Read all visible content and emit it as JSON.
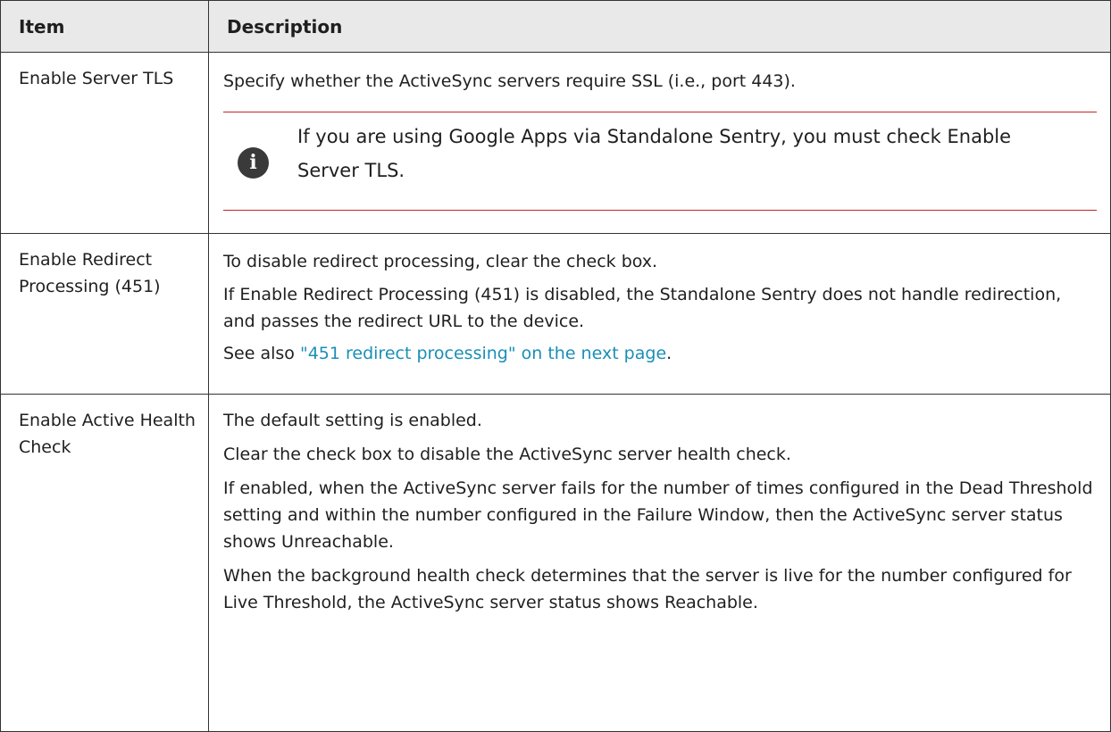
{
  "table": {
    "headers": [
      "Item",
      "Description"
    ],
    "rows": [
      {
        "item": "Enable Server TLS",
        "desc": [
          "Specify whether the ActiveSync servers require SSL (i.e., port 443)."
        ],
        "note": "If you are using Google Apps via Standalone Sentry, you must check Enable Server TLS."
      },
      {
        "item": "Enable Redirect Processing (451)",
        "desc": [
          "To disable redirect processing, clear the check box.",
          "If Enable Redirect Processing (451) is disabled, the Standalone Sentry does not handle redirection, and passes the redirect URL to the device."
        ],
        "see_also_prefix": "See also ",
        "see_also_link": "\"451 redirect processing\" on the next page",
        "see_also_suffix": "."
      },
      {
        "item": "Enable Active Health Check",
        "desc": [
          "The default setting is enabled.",
          "Clear the check box to disable the ActiveSync server health check.",
          "If enabled, when the ActiveSync server fails for the number of times configured in the Dead Threshold setting and within the number configured in the Failure Window, then the ActiveSync server status shows Unreachable.",
          "When the background health check determines that the server is live for the number configured for Live Threshold, the ActiveSync server status shows Reachable."
        ]
      }
    ]
  },
  "colors": {
    "header_bg": "#e9e9e9",
    "note_rule": "#c0252a",
    "link": "#1a8fb6",
    "icon_bg": "#3a3a3a"
  },
  "icons": {
    "note": "info-icon"
  }
}
